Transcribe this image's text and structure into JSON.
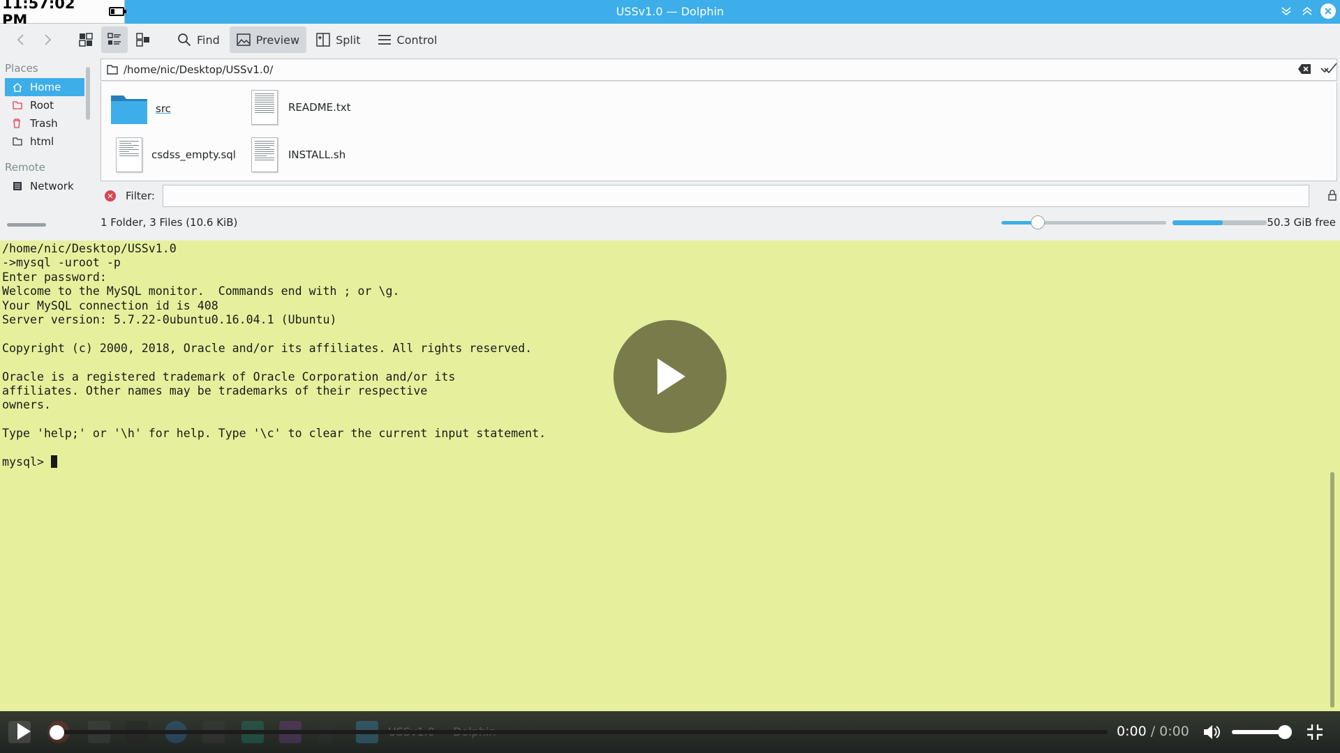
{
  "window": {
    "title": "USSv1.0 — Dolphin"
  },
  "clock": {
    "time": "11:57:02 PM"
  },
  "toolbar": {
    "find_label": "Find",
    "preview_label": "Preview",
    "split_label": "Split",
    "control_label": "Control"
  },
  "sidebar": {
    "places_header": "Places",
    "places": [
      {
        "label": "Home",
        "icon": "home-icon",
        "active": true
      },
      {
        "label": "Root",
        "icon": "folder-red-icon"
      },
      {
        "label": "Trash",
        "icon": "trash-icon"
      },
      {
        "label": "html",
        "icon": "folder-icon"
      }
    ],
    "remote_header": "Remote",
    "remote": [
      {
        "label": "Network",
        "icon": "network-icon"
      }
    ]
  },
  "location": {
    "path": "/home/nic/Desktop/USSv1.0/"
  },
  "files": [
    {
      "name": "src",
      "type": "folder"
    },
    {
      "name": "README.txt",
      "type": "text"
    },
    {
      "name": "csdss_empty.sql",
      "type": "text"
    },
    {
      "name": "INSTALL.sh",
      "type": "script"
    }
  ],
  "filter": {
    "label": "Filter:",
    "value": ""
  },
  "status": {
    "summary": "1 Folder, 3 Files (10.6 KiB)",
    "free_space": "50.3 GiB free",
    "zoom_fraction": 0.22,
    "disk_used_fraction": 0.53
  },
  "terminal": {
    "lines": [
      "/home/nic/Desktop/USSv1.0",
      "->mysql -uroot -p",
      "Enter password:",
      "Welcome to the MySQL monitor.  Commands end with ; or \\g.",
      "Your MySQL connection id is 408",
      "Server version: 5.7.22-0ubuntu0.16.04.1 (Ubuntu)",
      "",
      "Copyright (c) 2000, 2018, Oracle and/or its affiliates. All rights reserved.",
      "",
      "Oracle is a registered trademark of Oracle Corporation and/or its",
      "affiliates. Other names may be trademarks of their respective",
      "owners.",
      "",
      "Type 'help;' or '\\h' for help. Type '\\c' to clear the current input statement.",
      ""
    ],
    "prompt": "mysql> "
  },
  "player": {
    "current_time": "0:00",
    "separator": " / ",
    "total_time": "0:00",
    "volume_fraction": 0.85,
    "taskbar_ghost_text": "USSv1.0 — Dolphin"
  },
  "colors": {
    "accent": "#3daee9",
    "terminal_bg": "#e6f09c",
    "play_overlay": "#7a7b4b"
  }
}
